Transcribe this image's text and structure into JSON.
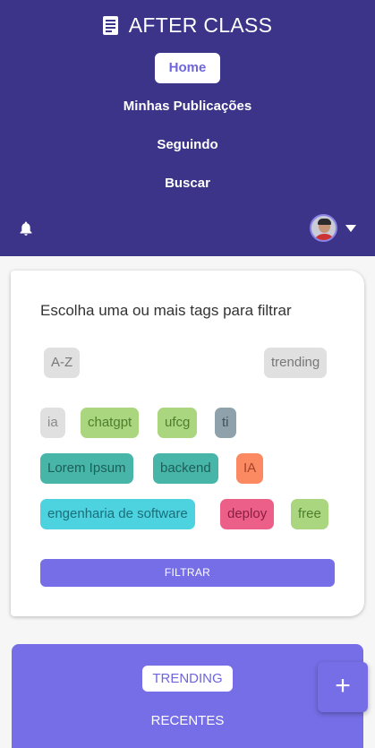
{
  "header": {
    "app_title": "AFTER CLASS",
    "nav": [
      {
        "label": "Home",
        "active": true
      },
      {
        "label": "Minhas Publicações",
        "active": false
      },
      {
        "label": "Seguindo",
        "active": false
      },
      {
        "label": "Buscar",
        "active": false
      }
    ],
    "icons": {
      "brand": "newspaper-icon",
      "notifications": "bell-icon",
      "menu": "caret-down-icon"
    }
  },
  "filter": {
    "title": "Escolha uma ou mais tags para filtrar",
    "sort_options": [
      "A-Z",
      "trending"
    ],
    "tags": [
      {
        "label": "ia",
        "bg": "#e0e0e0",
        "fg": "#8a8a8a"
      },
      {
        "label": "chatgpt",
        "bg": "#a9d67e",
        "fg": "#4e7d2e"
      },
      {
        "label": "ufcg",
        "bg": "#a9d67e",
        "fg": "#4e7d2e"
      },
      {
        "label": "ti",
        "bg": "#8fa1ab",
        "fg": "#3f5058"
      },
      {
        "label": "Lorem Ipsum",
        "bg": "#48b5a9",
        "fg": "#1c5f58"
      },
      {
        "label": "backend",
        "bg": "#48b5a9",
        "fg": "#1c5f58"
      },
      {
        "label": "IA",
        "bg": "#fb8a62",
        "fg": "#a3432a"
      },
      {
        "label": "engenharia de software",
        "bg": "#4dd2e0",
        "fg": "#1a6f79"
      },
      {
        "label": "deploy",
        "bg": "#ec5f88",
        "fg": "#8a1f42"
      },
      {
        "label": "free",
        "bg": "#a9d67e",
        "fg": "#4e7d2e"
      }
    ],
    "submit_label": "FILTRAR"
  },
  "feed_sort": {
    "tabs": [
      {
        "label": "TRENDING",
        "active": true
      },
      {
        "label": "RECENTES",
        "active": false
      }
    ]
  },
  "fab": {
    "label": "+",
    "icon": "plus-icon"
  },
  "colors": {
    "header": "#3b3488",
    "accent": "#766ee6"
  }
}
